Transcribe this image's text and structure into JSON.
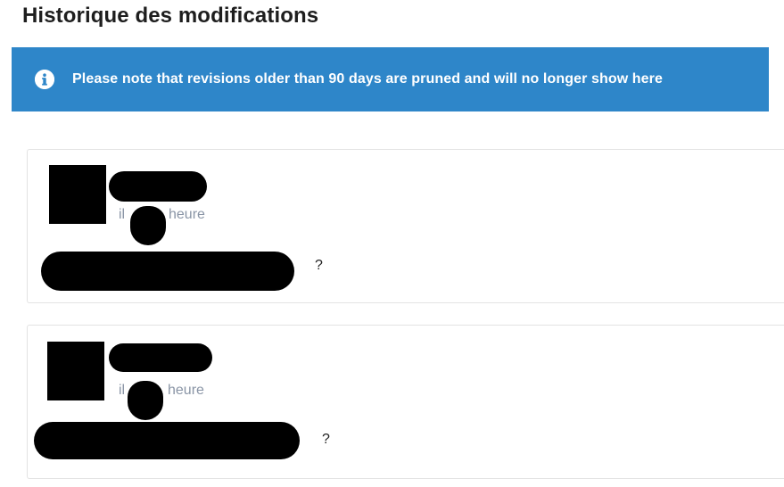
{
  "page": {
    "title": "Historique des modifications"
  },
  "banner": {
    "icon": "info-icon",
    "text": "Please note that revisions older than 90 days are pruned and will no longer show here",
    "background": "#2e86c9"
  },
  "revisions": [
    {
      "time_prefix": "il",
      "time_suffix": "heure",
      "summary_tail": "?"
    },
    {
      "time_prefix": "il",
      "time_suffix": "heure",
      "summary_tail": "?"
    }
  ]
}
